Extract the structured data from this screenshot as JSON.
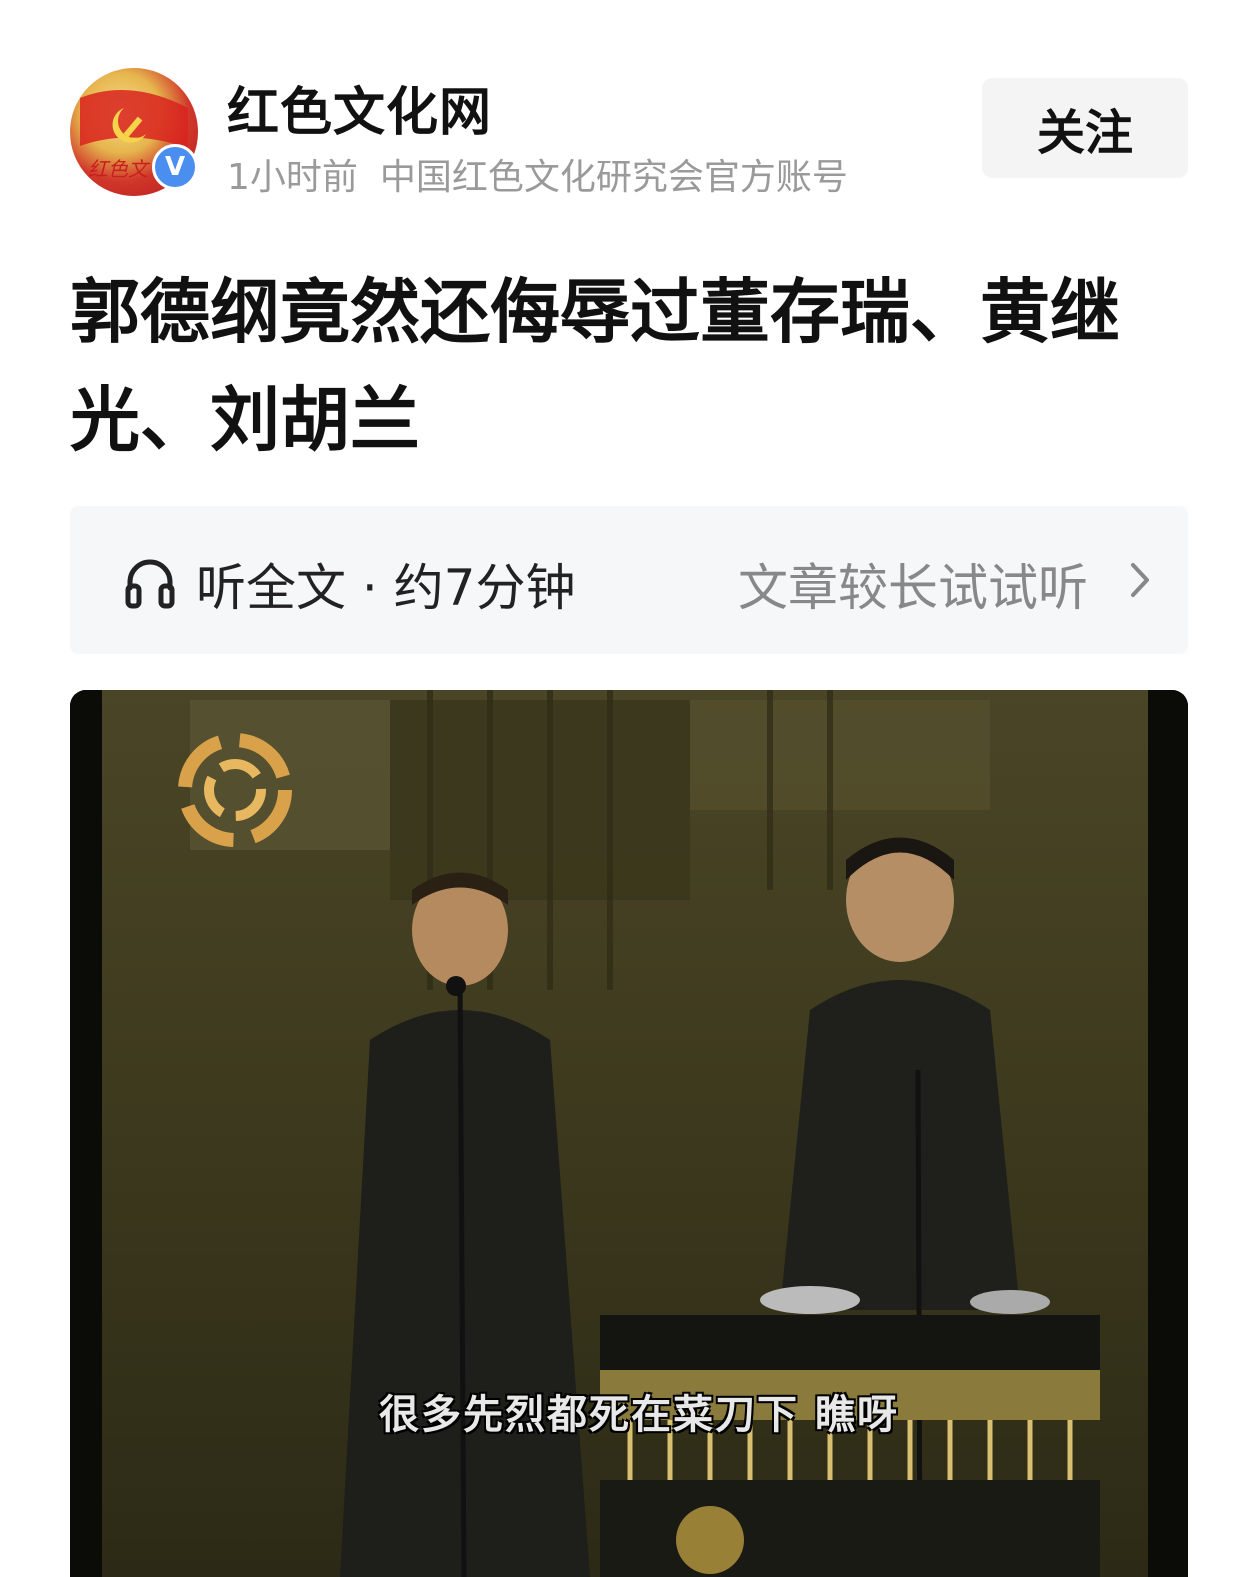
{
  "account": {
    "name": "红色文化网",
    "time": "1小时前",
    "description": "中国红色文化研究会官方账号",
    "verified_badge": "V",
    "avatar_script_text": "红色文"
  },
  "follow_button": {
    "label": "关注"
  },
  "article": {
    "title": "郭德纲竟然还侮辱过董存瑞、黄继光、刘胡兰"
  },
  "listen": {
    "label": "听全文 · 约7分钟",
    "hint": "文章较长试试听",
    "icon": "headphone-icon",
    "chevron": "chevron-right-icon"
  },
  "video": {
    "subtitle": "很多先烈都死在菜刀下 瞧呀",
    "channel_logo": "phoenix-logo-icon"
  },
  "colors": {
    "follow_bg": "#f4f4f4",
    "listen_bg": "#f6f7f9",
    "meta_text": "#9a9a9a",
    "verified_blue": "#4a8ef0"
  }
}
